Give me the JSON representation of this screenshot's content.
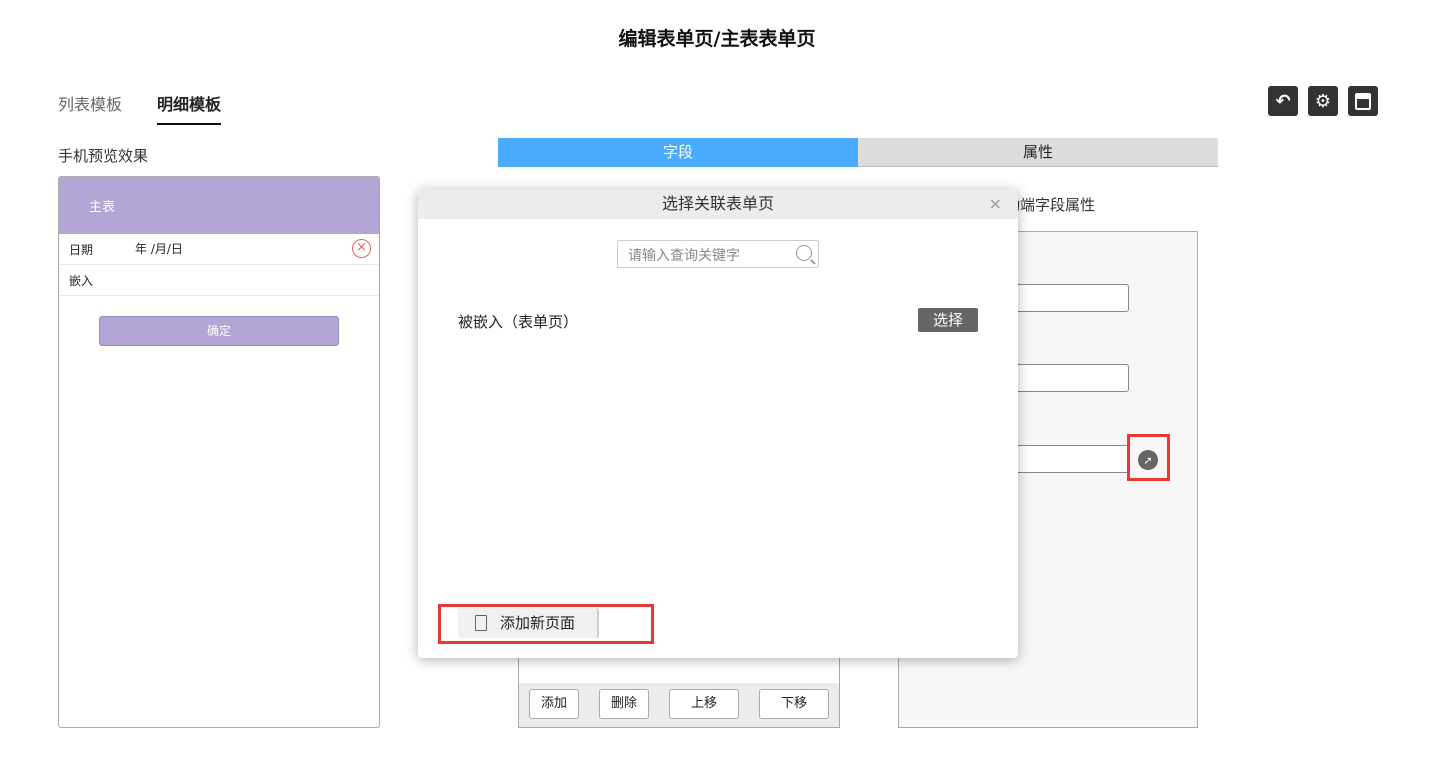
{
  "header": {
    "title": "编辑表单页/主表表单页"
  },
  "tabs": [
    {
      "label": "列表模板",
      "active": false
    },
    {
      "label": "明细模板",
      "active": true
    }
  ],
  "toolbar": {
    "icons": [
      "back-icon",
      "gear-icon",
      "save-icon"
    ]
  },
  "preview": {
    "label": "手机预览效果",
    "header": "主表",
    "rows": [
      {
        "label": "日期",
        "value": "年 /月/日"
      },
      {
        "label": "嵌入",
        "value": ""
      }
    ],
    "confirm": "确定",
    "accent": "#b3a5d5"
  },
  "editor_tabs": [
    {
      "label": "字段",
      "active": true,
      "color": "#4aabfe"
    },
    {
      "label": "属性",
      "active": false
    }
  ],
  "field_list": {
    "buttons": [
      "添加",
      "删除",
      "上移",
      "下移"
    ]
  },
  "attr_panel": {
    "label": "移动端字段属性"
  },
  "modal": {
    "title": "选择关联表单页",
    "close": "×",
    "search_placeholder": "请输入查询关键字",
    "items": [
      {
        "label": "被嵌入（表单页）",
        "action": "选择"
      }
    ],
    "add_page": "添加新页面"
  }
}
